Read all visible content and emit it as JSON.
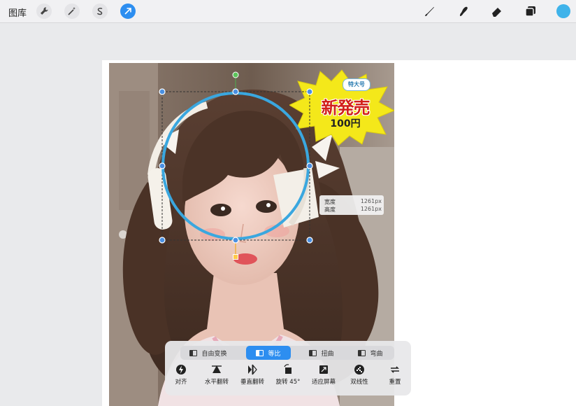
{
  "topbar": {
    "gallery_label": "图库",
    "left_tools": [
      {
        "name": "wrench-icon",
        "active": false
      },
      {
        "name": "magic-wand-icon",
        "active": false
      },
      {
        "name": "selection-s-icon",
        "active": false
      },
      {
        "name": "transform-arrow-icon",
        "active": true
      }
    ],
    "right_tools": [
      {
        "name": "brush-icon"
      },
      {
        "name": "smudge-icon"
      },
      {
        "name": "eraser-icon"
      },
      {
        "name": "layers-icon"
      }
    ],
    "current_color": "#3fb3ea"
  },
  "sticker": {
    "badge": "特大号",
    "headline": "新発売",
    "price": "100円",
    "fill_color": "#f4e81a",
    "text_color": "#d2201a"
  },
  "size_tag": {
    "width_label": "宽度",
    "width_value": "1261px",
    "height_label": "高度",
    "height_value": "1261px"
  },
  "transform_panel": {
    "modes": [
      {
        "label": "自由变换",
        "active": false
      },
      {
        "label": "等比",
        "active": true
      },
      {
        "label": "扭曲",
        "active": false
      },
      {
        "label": "弯曲",
        "active": false
      }
    ],
    "actions": [
      {
        "label": "对齐",
        "icon": "snap-icon"
      },
      {
        "label": "水平翻转",
        "icon": "flip-horizontal-icon"
      },
      {
        "label": "垂直翻转",
        "icon": "flip-vertical-icon"
      },
      {
        "label": "旋转 45°",
        "icon": "rotate-45-icon"
      },
      {
        "label": "适应屏幕",
        "icon": "fit-to-screen-icon"
      },
      {
        "label": "双线性",
        "icon": "bilinear-icon"
      },
      {
        "label": "重置",
        "icon": "reset-icon"
      }
    ]
  },
  "colors": {
    "accent": "#2d8ef0",
    "selection_circle": "#3aa7df"
  }
}
